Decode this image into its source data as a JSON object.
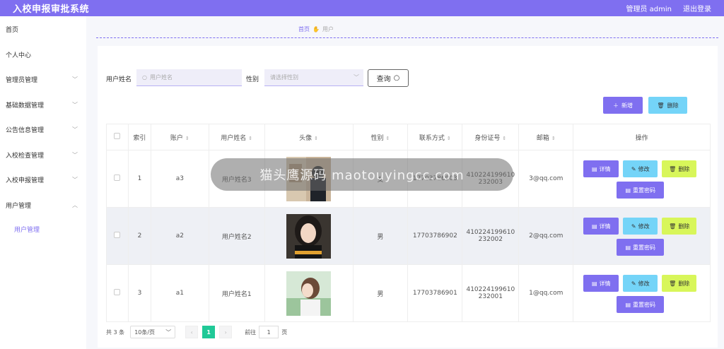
{
  "header": {
    "title": "入校申报审批系统",
    "admin_label": "管理员 admin",
    "logout_label": "退出登录"
  },
  "sidebar": {
    "items": [
      {
        "label": "首页"
      },
      {
        "label": "个人中心"
      },
      {
        "label": "管理员管理"
      },
      {
        "label": "基础数据管理"
      },
      {
        "label": "公告信息管理"
      },
      {
        "label": "入校检查管理"
      },
      {
        "label": "入校申报管理"
      },
      {
        "label": "用户管理"
      },
      {
        "label": "用户管理"
      }
    ]
  },
  "breadcrumb": {
    "home": "首页",
    "current": "用户"
  },
  "search": {
    "name_label": "用户姓名",
    "name_placeholder": "用户姓名",
    "gender_label": "性别",
    "gender_placeholder": "请选择性别",
    "query_label": "查询"
  },
  "actions": {
    "add_label": "新增",
    "delete_label": "删除"
  },
  "table": {
    "headers": [
      "索引",
      "账户",
      "用户姓名",
      "头像",
      "性别",
      "联系方式",
      "身份证号",
      "邮箱",
      "操作"
    ],
    "rows": [
      {
        "index": "1",
        "account": "a3",
        "name": "用户姓名3",
        "gender": "女",
        "phone": "17703786903",
        "id_line1": "410224199610",
        "id_line2": "232003",
        "email": "3@qq.com"
      },
      {
        "index": "2",
        "account": "a2",
        "name": "用户姓名2",
        "gender": "男",
        "phone": "17703786902",
        "id_line1": "410224199610",
        "id_line2": "232002",
        "email": "2@qq.com"
      },
      {
        "index": "3",
        "account": "a1",
        "name": "用户姓名1",
        "gender": "男",
        "phone": "17703786901",
        "id_line1": "410224199610",
        "id_line2": "232001",
        "email": "1@qq.com"
      }
    ],
    "row_actions": {
      "detail": "详情",
      "edit": "修改",
      "delete": "删除",
      "reset": "重置密码"
    }
  },
  "pagination": {
    "total": "共 3 条",
    "page_size": "10条/页",
    "current_page": "1",
    "goto_prefix": "前往",
    "goto_value": "1",
    "goto_suffix": "页"
  },
  "watermark": {
    "text": "猫头鹰源码 maotouyingcc.com"
  },
  "colors": {
    "primary": "#7f6ff0",
    "cyan": "#74d4f8",
    "lime": "#d8f65a",
    "pager_active": "#20c997"
  }
}
